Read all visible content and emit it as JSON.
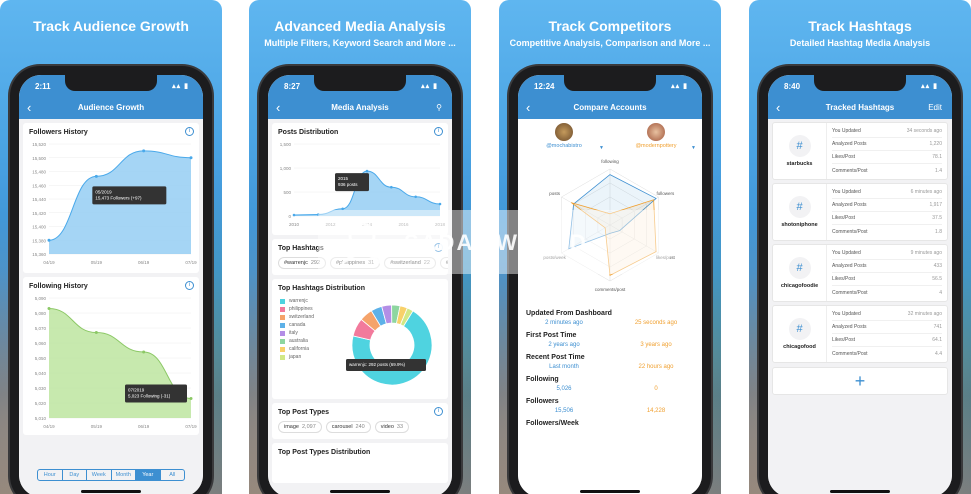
{
  "panels": [
    {
      "title": "Track Audience Growth",
      "subtitle": "",
      "time": "2:11",
      "nav_title": "Audience Growth",
      "followers_history": {
        "title": "Followers History",
        "tooltip_date": "05/2019",
        "tooltip_text": "15,473 Followers (+97)",
        "chart_data": {
          "type": "area",
          "x": [
            "04/19",
            "05/19",
            "06/19",
            "07/19"
          ],
          "values": [
            15380,
            15473,
            15510,
            15500
          ],
          "y_ticks": [
            "15,520",
            "15,500",
            "15,480",
            "15,460",
            "15,440",
            "15,420",
            "15,400",
            "15,380",
            "15,360"
          ],
          "ylim": [
            15360,
            15520
          ]
        }
      },
      "following_history": {
        "title": "Following History",
        "tooltip_date": "07/2019",
        "tooltip_text": "5,023 Following (-31)",
        "chart_data": {
          "type": "area",
          "x": [
            "04/19",
            "05/19",
            "06/19",
            "07/19"
          ],
          "values": [
            5083,
            5067,
            5054,
            5023
          ],
          "y_ticks": [
            "5,090",
            "5,080",
            "5,070",
            "5,060",
            "5,050",
            "5,040",
            "5,030",
            "5,020",
            "5,010"
          ],
          "ylim": [
            5010,
            5090
          ]
        }
      },
      "ranges": [
        "Hour",
        "Day",
        "Week",
        "Month",
        "Year",
        "All"
      ],
      "active_range": "Year"
    },
    {
      "title": "Advanced Media Analysis",
      "subtitle": "Multiple Filters, Keyword Search and More ...",
      "time": "8:27",
      "nav_title": "Media Analysis",
      "posts_distribution": {
        "title": "Posts Distribution",
        "tooltip_year": "2015",
        "tooltip_text": "936 posts",
        "chart_data": {
          "type": "area",
          "x": [
            "2010",
            "2012",
            "2014",
            "2016",
            "2018"
          ],
          "values": [
            20,
            30,
            150,
            936,
            600,
            400,
            250
          ],
          "y_ticks": [
            "1,500",
            "1,000",
            "500",
            "0"
          ],
          "ylim": [
            0,
            1500
          ]
        }
      },
      "top_hashtags": {
        "title": "Top Hashtags",
        "chips": [
          {
            "tag": "#warrenjc",
            "count": "292"
          },
          {
            "tag": "#philippines",
            "count": "31"
          },
          {
            "tag": "#switzerland",
            "count": "22"
          },
          {
            "tag": "#i",
            "count": ""
          }
        ]
      },
      "top_hashtags_distribution": {
        "title": "Top Hashtags Distribution",
        "tooltip_text": "warrenjc: 292 posts (69.9%)",
        "chart_data": {
          "type": "pie",
          "labels": [
            "warrenjc",
            "philippines",
            "switzerland",
            "canada",
            "italy",
            "australia",
            "california",
            "japan"
          ],
          "values": [
            69.9,
            7.4,
            5.3,
            4.5,
            4.0,
            3.4,
            3.0,
            2.5
          ],
          "colors": [
            "#4fd3e0",
            "#f27a9c",
            "#f5a36a",
            "#5db1e8",
            "#b38ee6",
            "#8ed6a0",
            "#f8d16a",
            "#d1e886"
          ]
        }
      },
      "top_post_types": {
        "title": "Top Post Types",
        "chips": [
          {
            "tag": "image",
            "count": "2,097"
          },
          {
            "tag": "carousel",
            "count": "240"
          },
          {
            "tag": "video",
            "count": "33"
          }
        ]
      },
      "top_post_types_distribution": {
        "title": "Top Post Types Distribution"
      }
    },
    {
      "title": "Track Competitors",
      "subtitle": "Competitive Analysis, Comparison and More ...",
      "time": "12:24",
      "nav_title": "Compare Accounts",
      "account_a": "@mochabistro",
      "account_b": "@modernpottery",
      "radar_labels": [
        "following",
        "followers",
        "likes/post",
        "comments/post",
        "posts/week",
        "posts"
      ],
      "rows": [
        {
          "label": "Updated From Dashboard",
          "a": "2 minutes ago",
          "b": "25 seconds ago"
        },
        {
          "label": "First Post Time",
          "a": "2 years ago",
          "b": "3 years ago"
        },
        {
          "label": "Recent Post Time",
          "a": "Last month",
          "b": "22 hours ago"
        },
        {
          "label": "Following",
          "a": "5,026",
          "b": "0"
        },
        {
          "label": "Followers",
          "a": "15,506",
          "b": "14,228"
        },
        {
          "label": "Followers/Week",
          "a": "",
          "b": ""
        }
      ]
    },
    {
      "title": "Track Hashtags",
      "subtitle": "Detailed Hashtag Media Analysis",
      "time": "8:40",
      "nav_title": "Tracked Hashtags",
      "edit_label": "Edit",
      "tags": [
        {
          "name": "starbucks",
          "updated": "34 seconds ago",
          "analyzed": "1,220",
          "likes": "78.1",
          "comments": "1.4"
        },
        {
          "name": "shotoniphone",
          "updated": "6 minutes ago",
          "analyzed": "1,917",
          "likes": "37.5",
          "comments": "1.8"
        },
        {
          "name": "chicagofoodie",
          "updated": "9 minutes ago",
          "analyzed": "433",
          "likes": "56.5",
          "comments": "4"
        },
        {
          "name": "chicagofood",
          "updated": "32 minutes ago",
          "analyzed": "741",
          "likes": "64.1",
          "comments": "4.4"
        }
      ],
      "row_labels": {
        "updated": "You Updated",
        "analyzed": "Analyzed Posts",
        "likes": "Likes/Post",
        "comments": "Comments/Post"
      }
    }
  ],
  "watermark": "SADAP.WEB.ID",
  "colors": {
    "accent": "#3d8fd1",
    "orange": "#f0a030",
    "followers_fill": "#8fcaf2",
    "following_fill": "#b9e39a"
  },
  "icons": {
    "back": "chevron-left-icon",
    "search": "search-icon",
    "info": "info-icon",
    "hash": "hash-icon",
    "add": "plus-icon"
  }
}
